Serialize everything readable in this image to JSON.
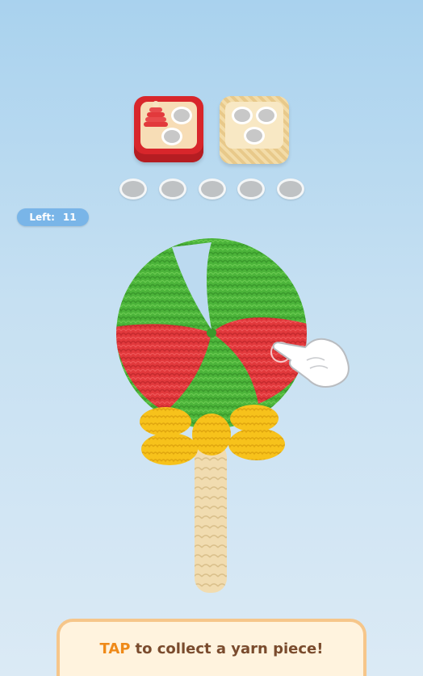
{
  "hud": {
    "left_label": "Left:",
    "left_count": "11"
  },
  "boxes": [
    {
      "name": "red-box",
      "color": "#d8262b",
      "holes": 3
    },
    {
      "name": "tan-box",
      "color": "#f3dca8",
      "holes": 3
    }
  ],
  "slots_count": 5,
  "hint": {
    "keyword": "TAP",
    "text": "to collect a yarn piece!"
  },
  "colors": {
    "yarn_green": "#4cb43a",
    "yarn_red": "#e2393c",
    "yarn_yellow": "#f7c21b",
    "stick": "#f1dcb0",
    "accent_orange": "#ef8a19"
  },
  "icons": [
    "yarn-spool-icon",
    "hand-pointer-icon"
  ]
}
